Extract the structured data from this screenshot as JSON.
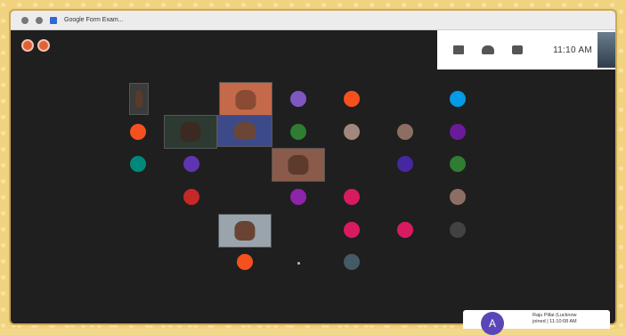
{
  "browser": {
    "tab_title": "Google Form Exam..."
  },
  "meet": {
    "clock": "11:10 AM",
    "colors": {
      "accent_orange": "#e0603a",
      "panel_white": "#ffffff",
      "call_bg": "#1f1f1f"
    },
    "icons": [
      "grid-icon",
      "people-icon",
      "chat-icon"
    ]
  },
  "participants": {
    "avatars": [
      {
        "letter": "",
        "color": "#7e57c2"
      },
      {
        "letter": "",
        "color": "#f4511e"
      },
      {
        "letter": "",
        "color": "#039be5"
      },
      {
        "letter": "",
        "color": "#f4511e"
      },
      {
        "letter": "",
        "color": "#2e7d32"
      },
      {
        "letter": "",
        "color": "#a1887f"
      },
      {
        "letter": "",
        "color": "#8d6e63"
      },
      {
        "letter": "",
        "color": "#6a1b9a"
      },
      {
        "letter": "",
        "color": "#00897b"
      },
      {
        "letter": "",
        "color": "#5e35b1"
      },
      {
        "letter": "",
        "color": "#4527a0"
      },
      {
        "letter": "",
        "color": "#2e7d32"
      },
      {
        "letter": "",
        "color": "#c62828"
      },
      {
        "letter": "",
        "color": "#8e24aa"
      },
      {
        "letter": "",
        "color": "#d81b60"
      },
      {
        "letter": "",
        "color": "#8d6e63"
      },
      {
        "letter": "",
        "color": "#d81b60"
      },
      {
        "letter": "",
        "color": "#d81b60"
      },
      {
        "letter": "",
        "color": "#424242"
      },
      {
        "letter": "",
        "color": "#f4511e"
      },
      {
        "letter": "",
        "color": "#455a64"
      }
    ]
  },
  "notification": {
    "avatar_letter": "A",
    "line1": "Raju Pillai (Lucknow",
    "line2": "joined | 11:10:08 AM"
  }
}
